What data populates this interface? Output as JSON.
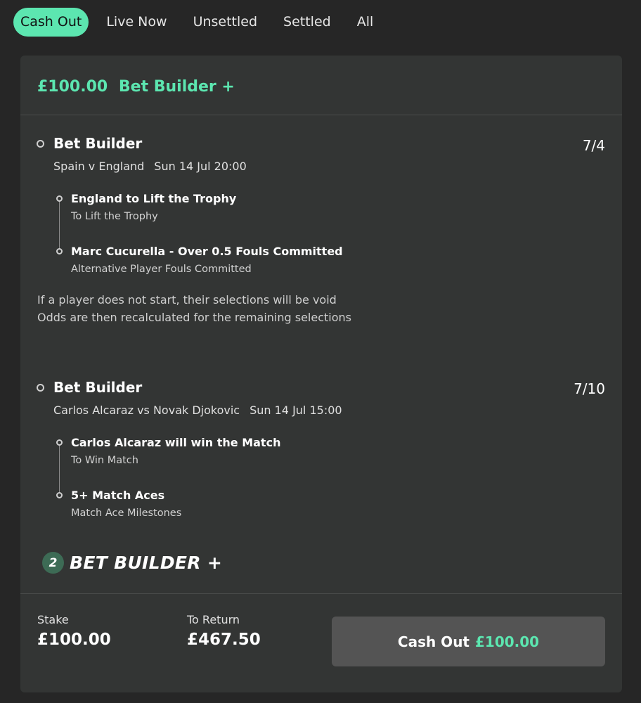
{
  "tabs": [
    {
      "label": "Cash Out",
      "active": true
    },
    {
      "label": "Live Now",
      "active": false
    },
    {
      "label": "Unsettled",
      "active": false
    },
    {
      "label": "Settled",
      "active": false
    },
    {
      "label": "All",
      "active": false
    }
  ],
  "bet": {
    "header_amount": "£100.00",
    "header_type": "Bet Builder +",
    "legs": [
      {
        "title": "Bet Builder",
        "odds": "7/4",
        "event": "Spain v England",
        "time": "Sun 14 Jul 20:00",
        "selections": [
          {
            "name": "England to Lift the Trophy",
            "market": "To Lift the Trophy"
          },
          {
            "name": "Marc Cucurella - Over 0.5 Fouls Committed",
            "market": "Alternative Player Fouls Committed"
          }
        ]
      },
      {
        "title": "Bet Builder",
        "odds": "7/10",
        "event": "Carlos Alcaraz vs Novak Djokovic",
        "time": "Sun 14 Jul 15:00",
        "selections": [
          {
            "name": "Carlos Alcaraz will win the Match",
            "market": "To Win Match"
          },
          {
            "name": "5+ Match Aces",
            "market": "Match Ace Milestones"
          }
        ]
      }
    ],
    "notice_line1": "If a player does not start, their selections will be void",
    "notice_line2": "Odds are then recalculated for the remaining selections",
    "badge_count": "2",
    "badge_text": "BET BUILDER +",
    "stake_label": "Stake",
    "stake_value": "£100.00",
    "return_label": "To Return",
    "return_value": "£467.50",
    "cashout_label": "Cash Out",
    "cashout_amount": "£100.00"
  },
  "colors": {
    "accent": "#5ce6b0",
    "background": "#262626",
    "card": "#333534",
    "button": "#545454"
  }
}
